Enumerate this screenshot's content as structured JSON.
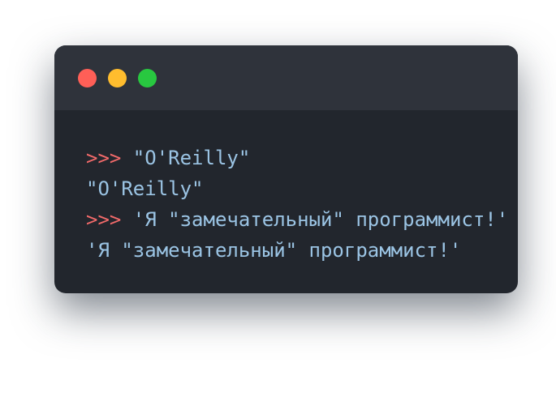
{
  "window": {
    "controls": [
      {
        "name": "close",
        "color": "#ff5f57"
      },
      {
        "name": "minimize",
        "color": "#ffbd2e"
      },
      {
        "name": "maximize",
        "color": "#28c840"
      }
    ]
  },
  "console": {
    "lines": [
      {
        "prompt": ">>>",
        "text": " \"O'Reilly\""
      },
      {
        "prompt": "",
        "text": "\"O'Reilly\""
      },
      {
        "prompt": ">>>",
        "text": " 'Я \"замечательный\" программист!'"
      },
      {
        "prompt": "",
        "text": "'Я \"замечательный\" программист!'"
      }
    ]
  },
  "colors": {
    "prompt": "#f26a6a",
    "string": "#9bc4e4",
    "background": "#22262d",
    "titlebar": "#2f333b"
  }
}
